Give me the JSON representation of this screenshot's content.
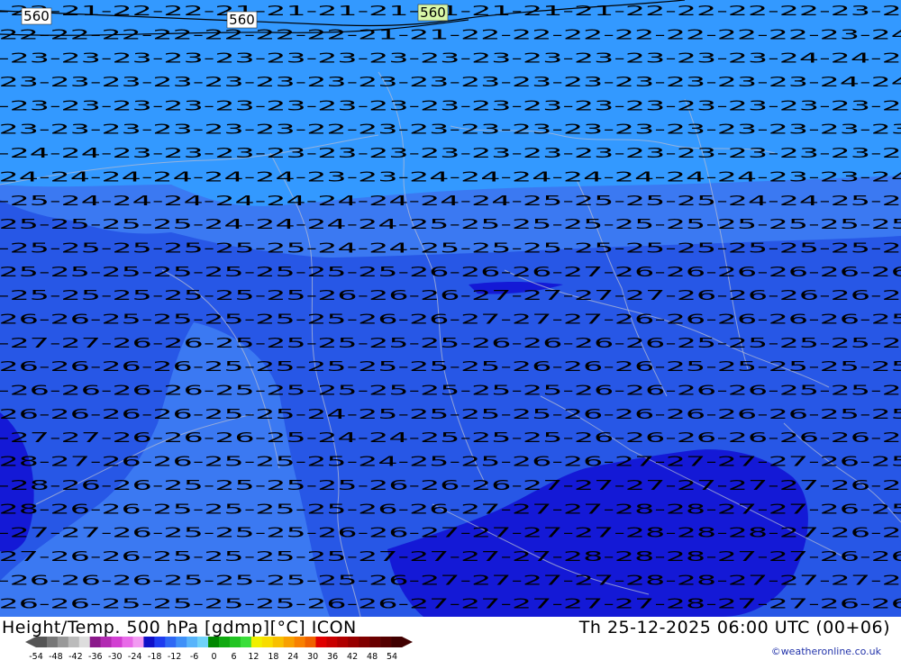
{
  "title": "Height/Temp. 500 hPa [gdmp][°C] ICON",
  "valid_time": "Th 25-12-2025 06:00 UTC (00+06)",
  "credit": "©weatheronline.co.uk",
  "isohypse_labels": [
    "560",
    "560",
    "560"
  ],
  "legend": {
    "ticks": [
      "-54",
      "-48",
      "-42",
      "-36",
      "-30",
      "-24",
      "-18",
      "-12",
      "-6",
      "0",
      "6",
      "12",
      "18",
      "24",
      "30",
      "36",
      "42",
      "48",
      "54"
    ],
    "colors": [
      "#555555",
      "#777777",
      "#999999",
      "#bbbbbb",
      "#dddddd",
      "#8b1a8b",
      "#b22ab2",
      "#d23fd2",
      "#e86ae8",
      "#f29af2",
      "#1010c8",
      "#1e3cf0",
      "#2e68f5",
      "#3f90f8",
      "#58b4fb",
      "#70d2f8",
      "#008800",
      "#10aa10",
      "#22c422",
      "#3ade3a",
      "#f0f000",
      "#f8dc00",
      "#f8c000",
      "#f8a000",
      "#f88000",
      "#f06000",
      "#e00000",
      "#c80000",
      "#b00000",
      "#980000",
      "#800000",
      "#6a0000",
      "#540000",
      "#400000"
    ]
  },
  "colors": {
    "temp_m22": "#3399ff",
    "temp_m24": "#3b79f2",
    "temp_m26": "#2757e6",
    "temp_m28": "#1419d6",
    "contour": "#000000",
    "border": "#b4bbd3"
  },
  "temperature_rows": [
    "-22-21-22-22-21-21-21-21-21-21-21-21-22-22-22-22-23-23",
    "-22-22-22-22-22-22-22-21-21-22-22-22-22-22-22-22-23-24",
    "-23-23-23-23-23-23-23-23-23-23-23-23-23-23-23-24-24-24",
    "-23-23-23-23-23-23-23-23-23-23-23-23-23-23-23-23-24-24",
    "-23-23-23-23-23-23-23-23-23-23-23-23-23-23-23-23-23-24",
    "-23-23-23-23-23-23-22-23-23-23-23-23-23-23-23-23-23-23",
    "-24-24-23-23-23-23-23-23-23-23-23-23-23-23-23-23-23-23",
    "-24-24-24-24-24-24-23-23-24-24-24-24-24-24-24-23-23-24",
    "-25-24-24-24-24-24-24-24-24-24-25-25-25-25-24-24-25-25",
    "-25-25-25-25-24-24-24-24-25-25-25-25-25-25-25-25-25-25",
    "-25-25-25-25-25-25-24-24-25-25-25-25-25-25-25-25-25-26",
    "-25-25-25-25-25-25-25-25-26-26-26-27-26-26-26-26-26-26",
    "-25-25-25-25-25-25-26-26-26-27-27-27-27-26-26-26-26-26",
    "-26-26-25-25-25-25-25-26-26-27-27-27-26-26-26-26-26-25",
    "-27-27-26-26-25-25-25-25-25-26-26-26-26-25-25-25-25-25",
    "-26-26-26-26-25-25-25-25-25-25-26-26-26-25-25-25-25-25",
    "-26-26-26-26-25-25-25-25-25-25-25-26-26-26-26-25-25-25",
    "-26-26-26-26-25-25-24-25-25-25-25-26-26-26-26-26-25-25",
    "-27-27-26-26-26-25-24-24-25-25-25-26-26-26-26-26-26-26",
    "-28-27-26-26-25-25-25-24-25-25-26-26-27-27-27-27-26-25",
    "-28-26-26-25-25-25-25-26-26-26-27-27-27-27-27-27-26-25",
    "-28-26-26-25-25-25-25-26-26-27-27-27-28-28-27-27-26-25",
    "-27-27-26-25-25-25-26-26-27-27-27-27-28-28-28-27-26-26",
    "-27-26-26-25-25-25-25-27-27-27-27-28-28-28-27-27-26-26",
    "-26-26-26-25-25-25-25-26-27-27-27-27-28-28-27-27-27-26",
    "-26-26-25-25-25-25-26-26-27-27-27-27-27-28-27-27-26-26"
  ]
}
